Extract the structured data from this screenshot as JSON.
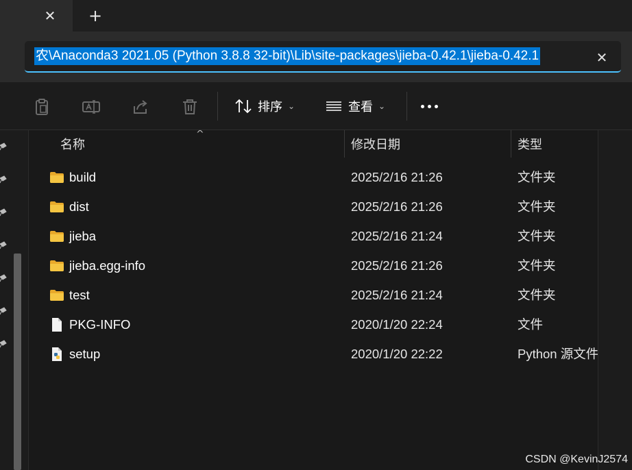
{
  "tabs": {
    "close_glyph": "✕",
    "new_glyph": "+"
  },
  "address": {
    "path": "农\\Anaconda3 2021.05 (Python 3.8.8 32-bit)\\Lib\\site-packages\\jieba-0.42.1\\jieba-0.42.1",
    "clear_glyph": "✕"
  },
  "toolbar": {
    "sort_label": "排序",
    "view_label": "查看",
    "chevron": "⌄",
    "icons": [
      "clipboard-icon",
      "rename-icon",
      "share-icon",
      "delete-icon"
    ]
  },
  "columns": {
    "name": "名称",
    "modified": "修改日期",
    "type": "类型",
    "sort_caret": "^"
  },
  "files": [
    {
      "name": "build",
      "modified": "2025/2/16 21:26",
      "type": "文件夹",
      "icon": "folder"
    },
    {
      "name": "dist",
      "modified": "2025/2/16 21:26",
      "type": "文件夹",
      "icon": "folder"
    },
    {
      "name": "jieba",
      "modified": "2025/2/16 21:24",
      "type": "文件夹",
      "icon": "folder"
    },
    {
      "name": "jieba.egg-info",
      "modified": "2025/2/16 21:26",
      "type": "文件夹",
      "icon": "folder"
    },
    {
      "name": "test",
      "modified": "2025/2/16 21:24",
      "type": "文件夹",
      "icon": "folder"
    },
    {
      "name": "PKG-INFO",
      "modified": "2020/1/20 22:24",
      "type": "文件",
      "icon": "file"
    },
    {
      "name": "setup",
      "modified": "2020/1/20 22:22",
      "type": "Python 源文件",
      "icon": "python-file"
    }
  ],
  "watermark": "CSDN @KevinJ2574",
  "colors": {
    "accent": "#4cc2ff",
    "selection": "#0078d4",
    "folder": "#f5c542"
  }
}
